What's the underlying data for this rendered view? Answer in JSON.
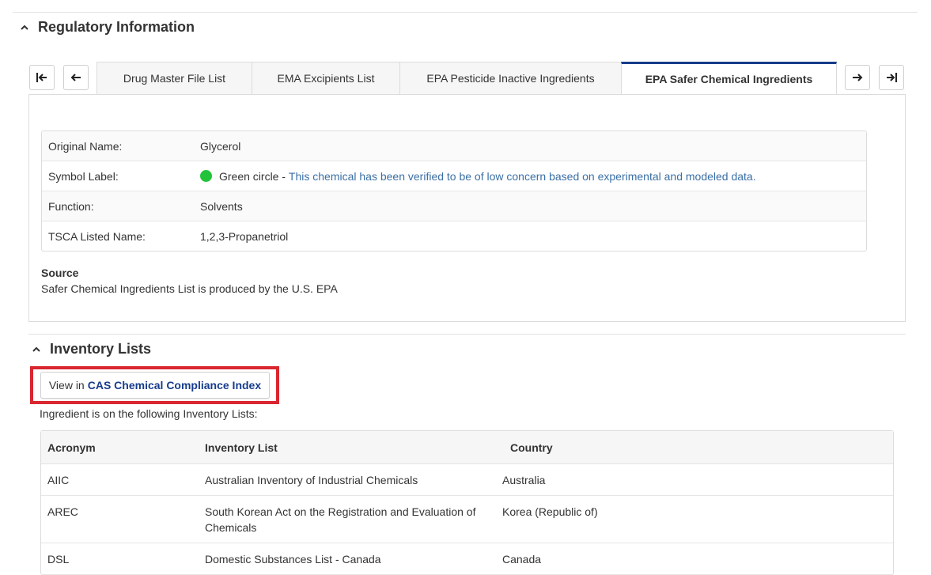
{
  "regulatory": {
    "title": "Regulatory Information",
    "tabs": [
      {
        "label": "Drug Master File List"
      },
      {
        "label": "EMA Excipients List"
      },
      {
        "label": "EPA Pesticide Inactive Ingredients"
      },
      {
        "label": "EPA Safer Chemical Ingredients"
      }
    ],
    "active_tab": "EPA Safer Chemical Ingredients",
    "info_rows": [
      {
        "label": "Original Name:",
        "value": "Glycerol"
      },
      {
        "label": "Symbol Label:",
        "value": "Green circle - ",
        "link": "This chemical has been verified to be of low concern based on experimental and modeled data."
      },
      {
        "label": "Function:",
        "value": "Solvents"
      },
      {
        "label": "TSCA Listed Name:",
        "value": "1,2,3-Propanetriol"
      }
    ],
    "source_heading": "Source",
    "source_text": "Safer Chemical Ingredients List is produced by the U.S. EPA"
  },
  "inventory": {
    "title": "Inventory Lists",
    "button_prefix": "View in",
    "button_strong": "CAS Chemical Compliance Index",
    "intro": "Ingredient is on the following Inventory Lists:",
    "headers": {
      "acronym": "Acronym",
      "list": "Inventory List",
      "country": "Country"
    },
    "rows": [
      {
        "acronym": "AIIC",
        "list": "Australian Inventory of Industrial Chemicals",
        "country": "Australia"
      },
      {
        "acronym": "AREC",
        "list": "South Korean Act on the Registration and Evaluation of Chemicals",
        "country": "Korea (Republic of)"
      },
      {
        "acronym": "DSL",
        "list": "Domestic Substances List - Canada",
        "country": "Canada"
      }
    ]
  },
  "colors": {
    "accent": "#163c8c",
    "highlight": "#d9262f",
    "green": "#22c33a",
    "link": "#3a6fa5"
  },
  "icons": {
    "collapse": "chevron-up-icon",
    "first": "first-page-icon",
    "prev": "arrow-left-icon",
    "next": "arrow-right-icon",
    "last": "last-page-icon"
  }
}
